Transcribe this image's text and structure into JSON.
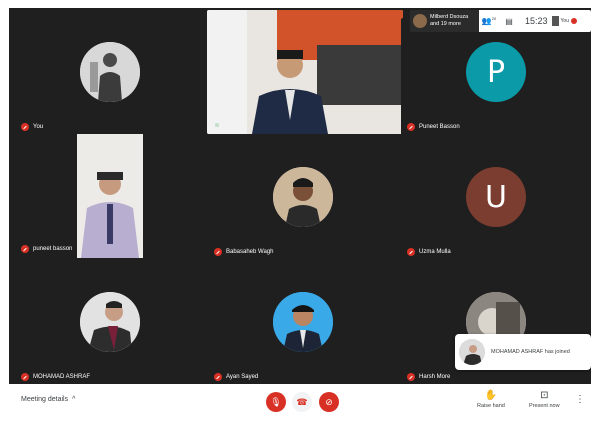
{
  "topbar": {
    "others_line1": "Milberd Dsouza",
    "others_line2": "and 19 more",
    "people_count": "20",
    "time": "15:23",
    "you_label": "You"
  },
  "tiles": [
    {
      "name": "You",
      "type": "photo",
      "mic": "off"
    },
    {
      "name": "",
      "type": "video",
      "mic": "on",
      "speaking_label": "●○"
    },
    {
      "name": "Puneet Basson",
      "type": "letter",
      "letter": "P",
      "color": "#0b9aa8",
      "mic": "off"
    },
    {
      "name": "puneet basson",
      "type": "video",
      "mic": "off"
    },
    {
      "name": "Babasaheb Wagh",
      "type": "photo",
      "mic": "off"
    },
    {
      "name": "Uzma Mulla",
      "type": "letter",
      "letter": "U",
      "color": "#7a3d2f",
      "mic": "off"
    },
    {
      "name": "MOHAMAD ASHRAF",
      "type": "photo",
      "mic": "off"
    },
    {
      "name": "Ayan Sayed",
      "type": "photo",
      "mic": "off"
    },
    {
      "name": "Harsh More",
      "type": "photo",
      "mic": "off"
    }
  ],
  "toast": {
    "text": "MOHAMAD ASHRAF has joined"
  },
  "controls": {
    "meeting_details": "Meeting details",
    "raise_hand": "Raise hand",
    "present_now": "Present now"
  },
  "colors": {
    "background": "#1f1f1f",
    "danger": "#d93025",
    "mic_on": "#81c995"
  }
}
